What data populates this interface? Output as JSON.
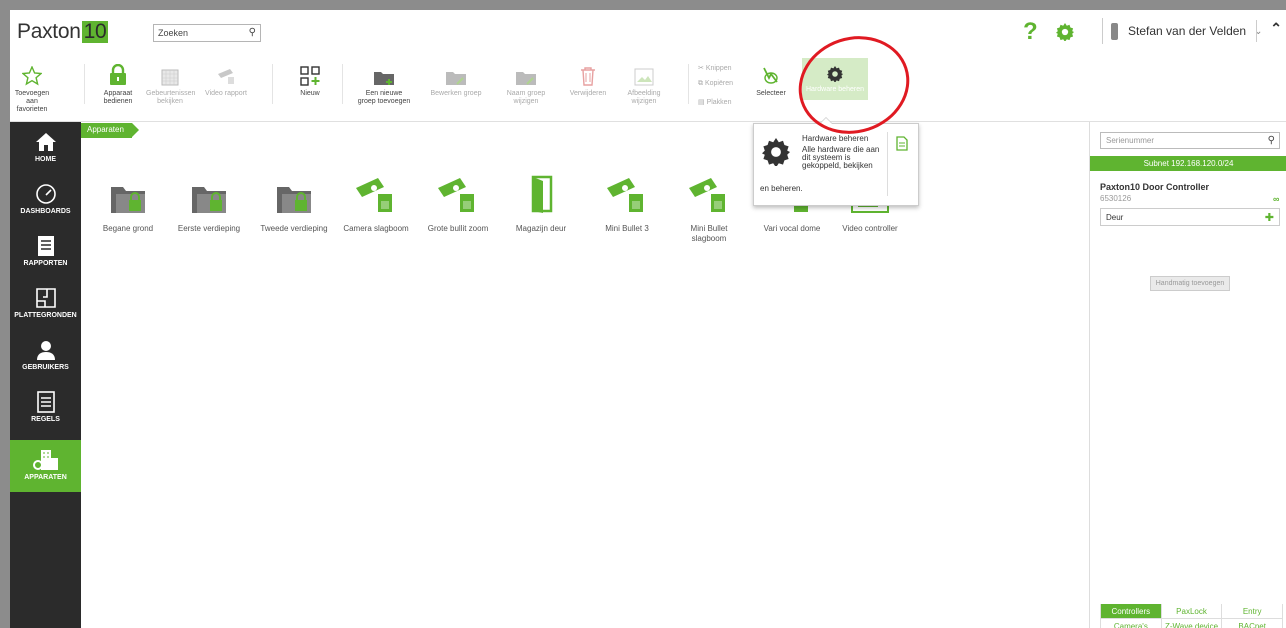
{
  "header": {
    "logo_text": "Paxton",
    "logo_number": "10",
    "search_value": "Zoeken",
    "help_label": "?",
    "user_name": "Stefan van der Velden"
  },
  "ribbon": {
    "items": [
      {
        "label": "Toevoegen aan favorieten"
      },
      {
        "label": "Apparaat bedienen"
      },
      {
        "label": "Gebeurtenissen bekijken"
      },
      {
        "label": "Video rapport"
      },
      {
        "label": "Nieuw"
      },
      {
        "label": "Een nieuwe groep toevoegen"
      },
      {
        "label": "Bewerken groep"
      },
      {
        "label": "Naam groep wijzigen"
      },
      {
        "label": "Verwijderen"
      },
      {
        "label": "Afbeelding wijzigen"
      },
      {
        "label": "Knippen"
      },
      {
        "label": "Kopiëren"
      },
      {
        "label": "Plakken"
      },
      {
        "label": "Selecteer"
      },
      {
        "label": "Hardware beheren"
      }
    ]
  },
  "sidebar": {
    "items": [
      {
        "label": "HOME"
      },
      {
        "label": "DASHBOARDS"
      },
      {
        "label": "RAPPORTEN"
      },
      {
        "label": "PLATTEGRONDEN"
      },
      {
        "label": "GEBRUIKERS"
      },
      {
        "label": "REGELS"
      },
      {
        "label": "APPARATEN"
      }
    ]
  },
  "breadcrumb": "Apparaten",
  "devices": [
    {
      "label": "Begane grond",
      "icon": "folder-icon"
    },
    {
      "label": "Eerste verdieping",
      "icon": "folder-icon"
    },
    {
      "label": "Tweede verdieping",
      "icon": "folder-icon"
    },
    {
      "label": "Camera slagboom",
      "icon": "camera-icon"
    },
    {
      "label": "Grote bullit zoom",
      "icon": "camera-icon"
    },
    {
      "label": "Magazijn deur",
      "icon": "door-icon"
    },
    {
      "label": "Mini Bullet 3",
      "icon": "camera-icon"
    },
    {
      "label": "Mini Bullet slagboom",
      "icon": "camera-icon"
    },
    {
      "label": "Vari vocal dome",
      "icon": "camera-icon"
    },
    {
      "label": "Video controller",
      "icon": "video-controller-icon"
    }
  ],
  "tooltip": {
    "title": "Hardware beheren",
    "text_a": "Alle hardware die aan dit systeem is gekoppeld, bekijken",
    "text_b": "en beheren."
  },
  "right_panel": {
    "serial_placeholder": "Serienummer",
    "subnet": "Subnet 192.168.120.0/24",
    "controller_name": "Paxton10 Door Controller",
    "controller_serial": "6530126",
    "door_label": "Deur",
    "manual_add": "Handmatig toevoegen",
    "tabs_row1": [
      "Controllers",
      "PaxLock",
      "Entry"
    ],
    "tabs_row2": [
      "Camera's",
      "Z-Wave device",
      "BACnet"
    ]
  },
  "colors": {
    "brand": "#5fb430",
    "sidebar": "#2b2b2b",
    "highlight": "#e01a22"
  }
}
